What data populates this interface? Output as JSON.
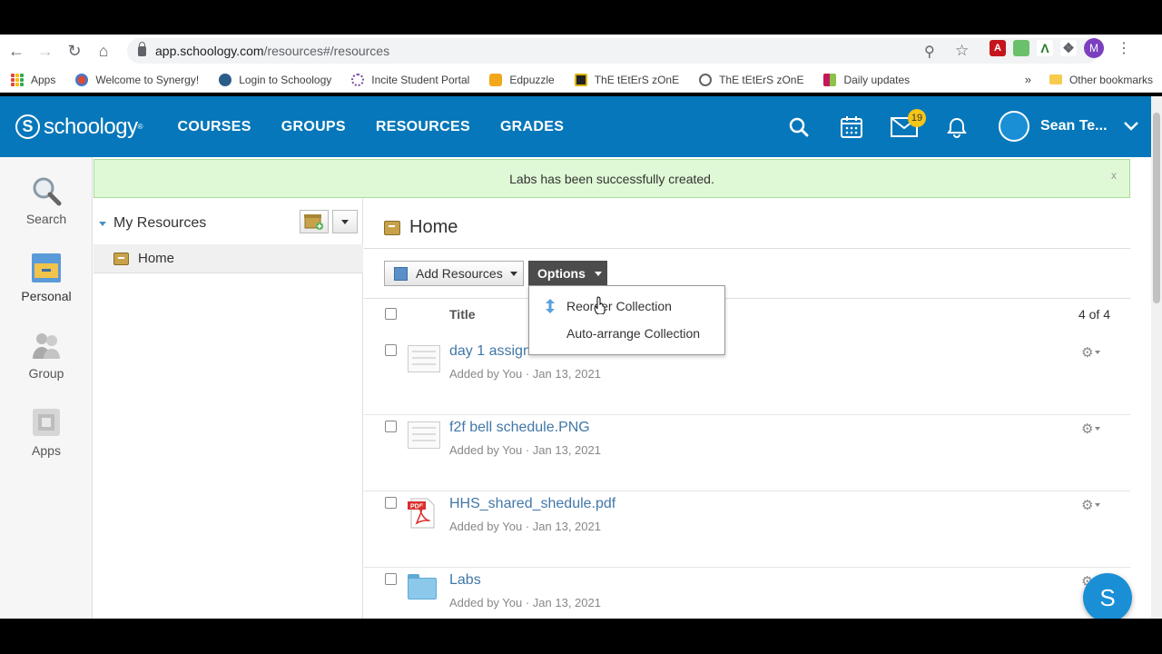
{
  "browser": {
    "url_domain": "app.schoology.com",
    "url_path": "/resources#/resources",
    "profile_initial": "M",
    "bookmarks": [
      {
        "label": "Apps",
        "icon": "apps-grid-icon"
      },
      {
        "label": "Welcome to Synergy!",
        "icon": "synergy-icon"
      },
      {
        "label": "Login to Schoology",
        "icon": "schoology-icon"
      },
      {
        "label": "Incite Student Portal",
        "icon": "incite-icon"
      },
      {
        "label": "Edpuzzle",
        "icon": "edpuzzle-icon"
      },
      {
        "label": "ThE tEtErS zOnE",
        "icon": "bookmark-icon"
      },
      {
        "label": "ThE tEtErS zOnE",
        "icon": "globe-icon"
      },
      {
        "label": "Daily updates",
        "icon": "bookmark-icon"
      }
    ],
    "more_bookmarks": "»",
    "other_bookmarks": "Other bookmarks"
  },
  "header": {
    "logo_text": "schoology",
    "logo_s": "S",
    "nav": [
      "COURSES",
      "GROUPS",
      "RESOURCES",
      "GRADES"
    ],
    "message_badge": "19",
    "user_name": "Sean Te...",
    "brand_color": "#0677ba"
  },
  "rail": {
    "items": [
      {
        "label": "Search",
        "icon": "magnifier-icon"
      },
      {
        "label": "Personal",
        "icon": "personal-icon"
      },
      {
        "label": "Group",
        "icon": "group-icon"
      },
      {
        "label": "Apps",
        "icon": "apps-icon"
      }
    ]
  },
  "alert": {
    "message": "Labs has been successfully created.",
    "close": "x"
  },
  "tree": {
    "title": "My Resources",
    "home": "Home"
  },
  "content": {
    "title": "Home",
    "add_resources": "Add Resources",
    "options": "Options",
    "column_title": "Title",
    "count": "4 of 4",
    "rows": [
      {
        "name": "day 1 assign.PNG",
        "meta": "Added by You · Jan 13, 2021",
        "type": "image"
      },
      {
        "name": "f2f bell schedule.PNG",
        "meta": "Added by You · Jan 13, 2021",
        "type": "image"
      },
      {
        "name": "HHS_shared_shedule.pdf",
        "meta": "Added by You · Jan 13, 2021",
        "type": "pdf"
      },
      {
        "name": "Labs",
        "meta": "Added by You · Jan 13, 2021",
        "type": "folder"
      }
    ]
  },
  "options_menu": {
    "items": [
      "Reorder Collection",
      "Auto-arrange Collection"
    ]
  },
  "fab_label": "S"
}
